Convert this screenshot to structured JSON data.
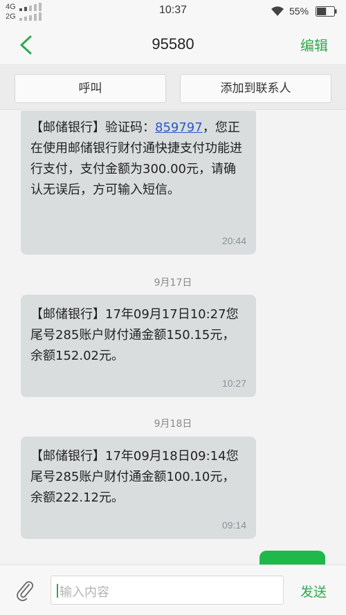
{
  "status_bar": {
    "network_top": "4G",
    "network_bottom": "2G",
    "time": "10:37",
    "battery_percent": "55%",
    "battery_level": 0.55
  },
  "header": {
    "title": "95580",
    "edit_label": "编辑"
  },
  "actions": {
    "call_label": "呼叫",
    "add_contact_label": "添加到联系人"
  },
  "messages": [
    {
      "text_prefix": "【邮储银行】验证码：",
      "code": "859797",
      "text_suffix": "，您正在使用邮储银行财付通快捷支付功能进行支付，支付金额为300.00元，请确认无误后，方可输入短信。",
      "time": "20:44"
    },
    {
      "date_header": "9月17日",
      "text": "【邮储银行】17年09月17日10:27您尾号285账户财付通金额150.15元，余额152.02元。",
      "time": "10:27"
    },
    {
      "date_header": "9月18日",
      "text": "【邮储银行】17年09月18日09:14您尾号285账户财付通金额100.10元，余额222.12元。",
      "time": "09:14"
    }
  ],
  "composer": {
    "placeholder": "输入内容",
    "send_label": "发送"
  },
  "colors": {
    "accent": "#2fa94e",
    "bubble": "#d9ddde",
    "link": "#2b58c6",
    "sent_bubble": "#1fb84a"
  }
}
